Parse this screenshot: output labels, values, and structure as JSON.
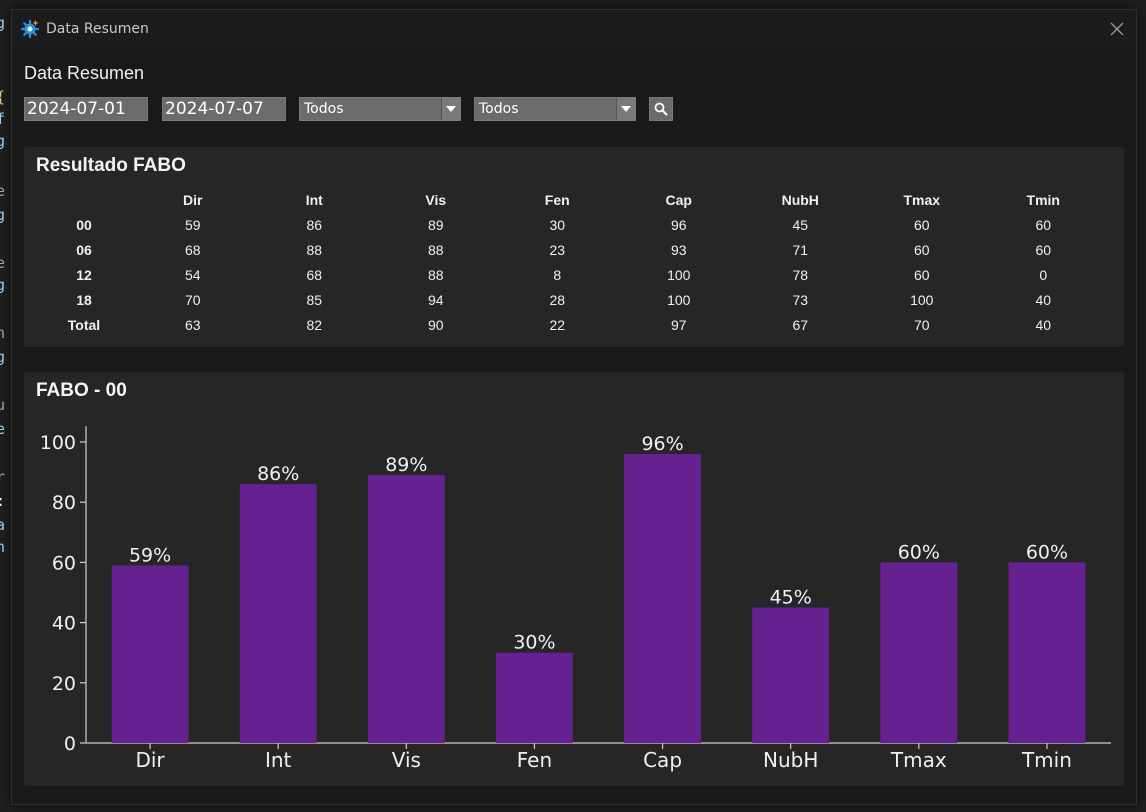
{
  "window": {
    "title": "Data Resumen",
    "icon": "gear-sparkle-icon",
    "close_icon": "close-icon"
  },
  "page": {
    "heading": "Data Resumen"
  },
  "filters": {
    "date_from": "2024-07-01",
    "date_to": "2024-07-07",
    "select1": "Todos",
    "select2": "Todos",
    "search_icon": "search-icon"
  },
  "table": {
    "title": "Resultado FABO",
    "columns": [
      "Dir",
      "Int",
      "Vis",
      "Fen",
      "Cap",
      "NubH",
      "Tmax",
      "Tmin"
    ],
    "rows": [
      {
        "label": "00",
        "values": [
          "59",
          "86",
          "89",
          "30",
          "96",
          "45",
          "60",
          "60"
        ]
      },
      {
        "label": "06",
        "values": [
          "68",
          "88",
          "88",
          "23",
          "93",
          "71",
          "60",
          "60"
        ]
      },
      {
        "label": "12",
        "values": [
          "54",
          "68",
          "88",
          "8",
          "100",
          "78",
          "60",
          "0"
        ]
      },
      {
        "label": "18",
        "values": [
          "70",
          "85",
          "94",
          "28",
          "100",
          "73",
          "100",
          "40"
        ]
      },
      {
        "label": "Total",
        "values": [
          "63",
          "82",
          "90",
          "22",
          "97",
          "67",
          "70",
          "40"
        ]
      }
    ]
  },
  "chart_data": {
    "type": "bar",
    "title": "FABO - 00",
    "categories": [
      "Dir",
      "Int",
      "Vis",
      "Fen",
      "Cap",
      "NubH",
      "Tmax",
      "Tmin"
    ],
    "values": [
      59,
      86,
      89,
      30,
      96,
      45,
      60,
      60
    ],
    "data_labels": [
      "59%",
      "86%",
      "89%",
      "30%",
      "96%",
      "45%",
      "60%",
      "60%"
    ],
    "ylim": [
      0,
      100
    ],
    "yticks": [
      0,
      20,
      40,
      60,
      80,
      100
    ],
    "xlabel": "",
    "ylabel": "",
    "grid": false,
    "bar_color": "#65218f",
    "background": "#262626"
  },
  "colors": {
    "window_bg": "#191919",
    "panel_bg": "#262626",
    "input_bg": "#6b6b6b",
    "text": "#f0f0f0"
  }
}
